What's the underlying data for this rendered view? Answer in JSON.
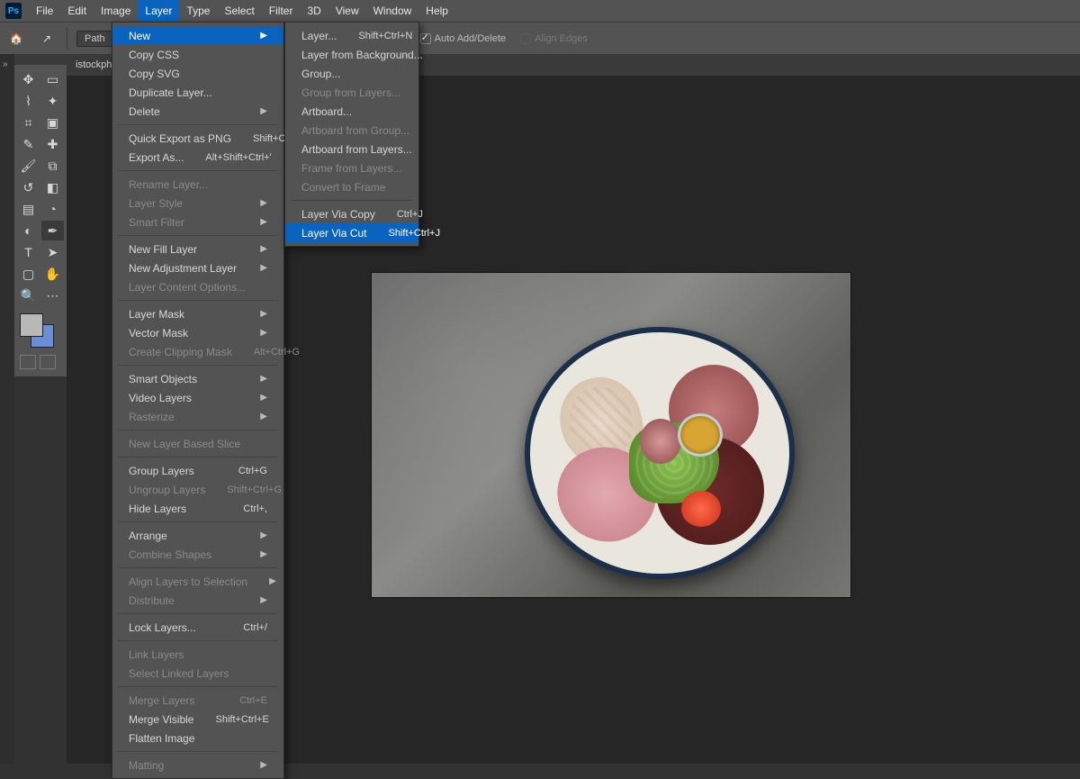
{
  "app": {
    "logo_text": "Ps"
  },
  "menubar": {
    "items": [
      "File",
      "Edit",
      "Image",
      "Layer",
      "Type",
      "Select",
      "Filter",
      "3D",
      "View",
      "Window",
      "Help"
    ],
    "active_index": 3
  },
  "optionsbar": {
    "path_button": "Path",
    "auto_add_delete": "Auto Add/Delete",
    "align_edges": "Align Edges"
  },
  "tab": {
    "label": "istockphoto"
  },
  "layer_menu": [
    {
      "label": "New",
      "submenu": true,
      "highlight": true
    },
    {
      "label": "Copy CSS"
    },
    {
      "label": "Copy SVG"
    },
    {
      "label": "Duplicate Layer..."
    },
    {
      "label": "Delete",
      "submenu": true
    },
    {
      "sep": true
    },
    {
      "label": "Quick Export as PNG",
      "shortcut": "Shift+Ctrl+'"
    },
    {
      "label": "Export As...",
      "shortcut": "Alt+Shift+Ctrl+'"
    },
    {
      "sep": true
    },
    {
      "label": "Rename Layer...",
      "disabled": true
    },
    {
      "label": "Layer Style",
      "submenu": true,
      "disabled": true
    },
    {
      "label": "Smart Filter",
      "submenu": true,
      "disabled": true
    },
    {
      "sep": true
    },
    {
      "label": "New Fill Layer",
      "submenu": true
    },
    {
      "label": "New Adjustment Layer",
      "submenu": true
    },
    {
      "label": "Layer Content Options...",
      "disabled": true
    },
    {
      "sep": true
    },
    {
      "label": "Layer Mask",
      "submenu": true
    },
    {
      "label": "Vector Mask",
      "submenu": true
    },
    {
      "label": "Create Clipping Mask",
      "shortcut": "Alt+Ctrl+G",
      "disabled": true
    },
    {
      "sep": true
    },
    {
      "label": "Smart Objects",
      "submenu": true
    },
    {
      "label": "Video Layers",
      "submenu": true
    },
    {
      "label": "Rasterize",
      "submenu": true,
      "disabled": true
    },
    {
      "sep": true
    },
    {
      "label": "New Layer Based Slice",
      "disabled": true
    },
    {
      "sep": true
    },
    {
      "label": "Group Layers",
      "shortcut": "Ctrl+G"
    },
    {
      "label": "Ungroup Layers",
      "shortcut": "Shift+Ctrl+G",
      "disabled": true
    },
    {
      "label": "Hide Layers",
      "shortcut": "Ctrl+,"
    },
    {
      "sep": true
    },
    {
      "label": "Arrange",
      "submenu": true
    },
    {
      "label": "Combine Shapes",
      "submenu": true,
      "disabled": true
    },
    {
      "sep": true
    },
    {
      "label": "Align Layers to Selection",
      "submenu": true,
      "disabled": true
    },
    {
      "label": "Distribute",
      "submenu": true,
      "disabled": true
    },
    {
      "sep": true
    },
    {
      "label": "Lock Layers...",
      "shortcut": "Ctrl+/"
    },
    {
      "sep": true
    },
    {
      "label": "Link Layers",
      "disabled": true
    },
    {
      "label": "Select Linked Layers",
      "disabled": true
    },
    {
      "sep": true
    },
    {
      "label": "Merge Layers",
      "shortcut": "Ctrl+E",
      "disabled": true
    },
    {
      "label": "Merge Visible",
      "shortcut": "Shift+Ctrl+E"
    },
    {
      "label": "Flatten Image"
    },
    {
      "sep": true
    },
    {
      "label": "Matting",
      "submenu": true,
      "disabled": true
    }
  ],
  "new_submenu": [
    {
      "label": "Layer...",
      "shortcut": "Shift+Ctrl+N"
    },
    {
      "label": "Layer from Background..."
    },
    {
      "label": "Group..."
    },
    {
      "label": "Group from Layers...",
      "disabled": true
    },
    {
      "label": "Artboard..."
    },
    {
      "label": "Artboard from Group...",
      "disabled": true
    },
    {
      "label": "Artboard from Layers..."
    },
    {
      "label": "Frame from Layers...",
      "disabled": true
    },
    {
      "label": "Convert to Frame",
      "disabled": true
    },
    {
      "sep": true
    },
    {
      "label": "Layer Via Copy",
      "shortcut": "Ctrl+J"
    },
    {
      "label": "Layer Via Cut",
      "shortcut": "Shift+Ctrl+J",
      "highlight": true
    }
  ],
  "tools": [
    [
      "move-tool",
      "marquee-tool"
    ],
    [
      "lasso-tool",
      "quick-select-tool"
    ],
    [
      "crop-tool",
      "frame-tool"
    ],
    [
      "eyedropper-tool",
      "spot-heal-tool"
    ],
    [
      "brush-tool",
      "clone-stamp-tool"
    ],
    [
      "history-brush-tool",
      "eraser-tool"
    ],
    [
      "gradient-tool",
      "blur-tool"
    ],
    [
      "dodge-tool",
      "pen-tool"
    ],
    [
      "type-tool",
      "path-select-tool"
    ],
    [
      "rectangle-tool",
      "hand-tool"
    ],
    [
      "zoom-tool",
      "edit-toolbar"
    ]
  ],
  "tool_glyphs": {
    "move-tool": "✥",
    "marquee-tool": "▭",
    "lasso-tool": "⌇",
    "quick-select-tool": "✦",
    "crop-tool": "⌗",
    "frame-tool": "▣",
    "eyedropper-tool": "✎",
    "spot-heal-tool": "✚",
    "brush-tool": "🖌",
    "clone-stamp-tool": "⧉",
    "history-brush-tool": "↺",
    "eraser-tool": "◧",
    "gradient-tool": "▤",
    "blur-tool": "◔",
    "dodge-tool": "◐",
    "pen-tool": "✒",
    "type-tool": "T",
    "path-select-tool": "➤",
    "rectangle-tool": "▢",
    "hand-tool": "✋",
    "zoom-tool": "🔍",
    "edit-toolbar": "⋯"
  }
}
